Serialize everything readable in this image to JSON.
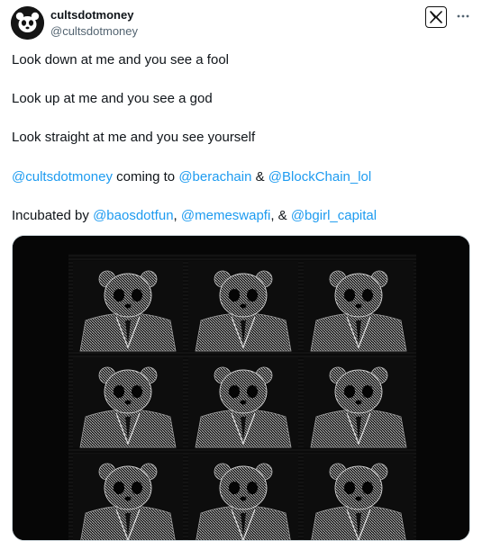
{
  "author": {
    "name": "cultsdotmoney",
    "handle": "@cultsdotmoney"
  },
  "icons": {
    "avatar": "panda-avatar",
    "brand": "x-logo-icon",
    "more": "more-icon"
  },
  "tweet": {
    "line1": "Look down at me and you see a fool",
    "line2": "Look up at me and you see a god",
    "line3": "Look straight at me and you see yourself",
    "line4": {
      "m1": "@cultsdotmoney",
      "t1": " coming to ",
      "m2": "@berachain",
      "t2": " & ",
      "m3": "@BlockChain_lol"
    },
    "line5": {
      "t1": "Incubated by ",
      "m1": "@baosdotfun",
      "t2": ", ",
      "m2": "@memeswapfi",
      "t3": ", & ",
      "m3": "@bgirl_capital"
    }
  },
  "colors": {
    "mention": "#1d9bf0",
    "text": "#0f1419",
    "secondary": "#536471",
    "media_bg": "#050505"
  }
}
